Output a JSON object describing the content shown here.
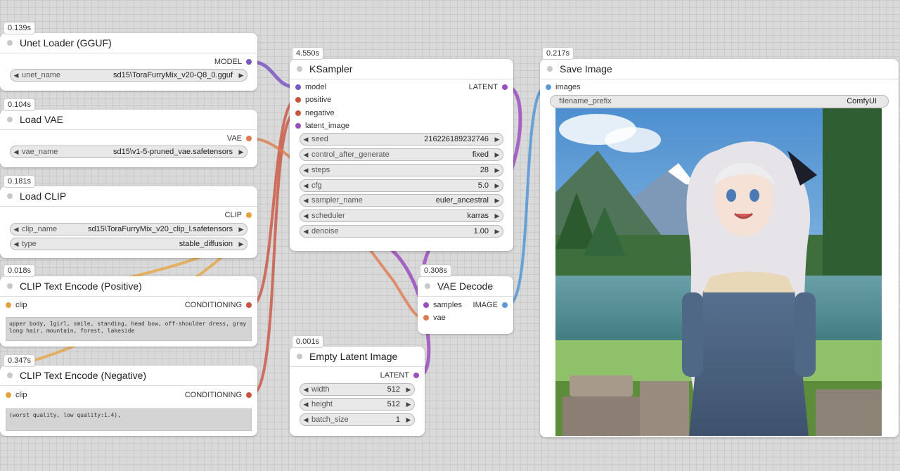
{
  "colors": {
    "model": "#7b57c4",
    "conditioning": "#c9543f",
    "latent": "#9b4fbf",
    "vae": "#de7a4e",
    "clip": "#e6a23c",
    "image": "#5b9ad6"
  },
  "nodes": {
    "unet_loader": {
      "timing": "0.139s",
      "title": "Unet Loader (GGUF)",
      "output": "MODEL",
      "widget": {
        "name": "unet_name",
        "value": "sd15\\ToraFurryMix_v20-Q8_0.gguf"
      }
    },
    "load_vae": {
      "timing": "0.104s",
      "title": "Load VAE",
      "output": "VAE",
      "widget": {
        "name": "vae_name",
        "value": "sd15\\v1-5-pruned_vae.safetensors"
      }
    },
    "load_clip": {
      "timing": "0.181s",
      "title": "Load CLIP",
      "output": "CLIP",
      "widgets": [
        {
          "name": "clip_name",
          "value": "sd15\\ToraFurryMix_v20_clip_l.safetensors"
        },
        {
          "name": "type",
          "value": "stable_diffusion"
        }
      ]
    },
    "clip_pos": {
      "timing": "0.018s",
      "title": "CLIP Text Encode (Positive)",
      "input": "clip",
      "output": "CONDITIONING",
      "text": "upper body, 1girl, smile, standing, head bow, off-shoulder dress, gray long hair, mountain, forest, lakeside"
    },
    "clip_neg": {
      "timing": "0.347s",
      "title": "CLIP Text Encode (Negative)",
      "input": "clip",
      "output": "CONDITIONING",
      "text": "(worst quality, low quality:1.4),"
    },
    "ksampler": {
      "timing": "4.550s",
      "title": "KSampler",
      "inputs": [
        "model",
        "positive",
        "negative",
        "latent_image"
      ],
      "output": "LATENT",
      "widgets": [
        {
          "name": "seed",
          "value": "216226189232746"
        },
        {
          "name": "control_after_generate",
          "value": "fixed"
        },
        {
          "name": "steps",
          "value": "28"
        },
        {
          "name": "cfg",
          "value": "5.0"
        },
        {
          "name": "sampler_name",
          "value": "euler_ancestral"
        },
        {
          "name": "scheduler",
          "value": "karras"
        },
        {
          "name": "denoise",
          "value": "1.00"
        }
      ]
    },
    "empty_latent": {
      "timing": "0.001s",
      "title": "Empty Latent Image",
      "output": "LATENT",
      "widgets": [
        {
          "name": "width",
          "value": "512"
        },
        {
          "name": "height",
          "value": "512"
        },
        {
          "name": "batch_size",
          "value": "1"
        }
      ]
    },
    "vae_decode": {
      "timing": "0.308s",
      "title": "VAE Decode",
      "inputs": [
        "samples",
        "vae"
      ],
      "output": "IMAGE"
    },
    "save_image": {
      "timing": "0.217s",
      "title": "Save Image",
      "input": "images",
      "widget": {
        "name": "filename_prefix",
        "value": "ComfyUI"
      }
    }
  }
}
